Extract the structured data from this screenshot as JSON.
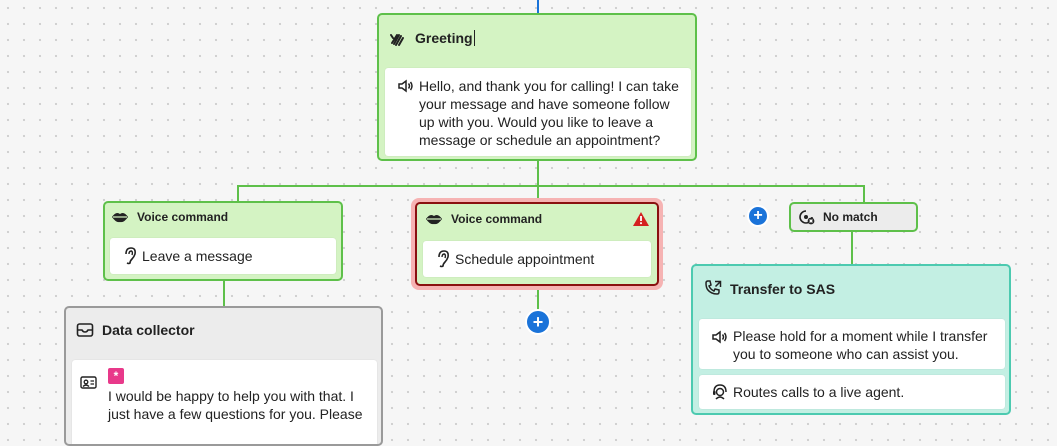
{
  "greeting": {
    "title": "Greeting",
    "message": "Hello, and thank you for calling! I can take your message and have someone follow up with you. Would you like to leave a message or schedule an appointment?"
  },
  "voice_command_left": {
    "title": "Voice command",
    "phrase": "Leave a message"
  },
  "voice_command_center": {
    "title": "Voice command",
    "phrase": "Schedule appointment"
  },
  "no_match": {
    "title": "No match"
  },
  "data_collector": {
    "title": "Data collector",
    "badge": "*",
    "message": "I would be happy to help you with that. I just have a few questions for you. Please"
  },
  "transfer": {
    "title": "Transfer to SAS",
    "hold_message": "Please hold for a moment while I transfer you to someone who can assist you.",
    "route_note": "Routes calls to a live agent."
  },
  "add_buttons": {
    "label": "+"
  },
  "colors": {
    "connector": "#5ec04a",
    "voice_node_fill": "#d4f3c3",
    "transfer_border": "#4ccab0",
    "transfer_fill": "#c3efe3",
    "data_collector_border": "#9a9a9a",
    "add_button": "#1a73d9",
    "warning": "#d42020",
    "error_outline": "#f2a5a5",
    "badge": "#e8398a"
  },
  "icons": {
    "greeting": "waving-hand-icon",
    "speaker": "speaker-icon",
    "voice": "lips-icon",
    "listen": "ear-icon",
    "warning": "warning-triangle-icon",
    "no_match": "no-match-icon",
    "data_collector": "inbox-tray-icon",
    "contact_card": "contact-card-icon",
    "phone_transfer": "phone-forward-icon",
    "agent": "agent-headset-icon"
  }
}
